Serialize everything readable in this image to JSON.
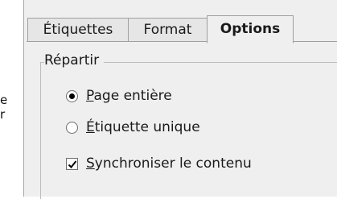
{
  "edge_text": [
    "e",
    "r"
  ],
  "tabs": [
    {
      "label": "Étiquettes"
    },
    {
      "label": "Format"
    },
    {
      "label": "Options",
      "active": true
    }
  ],
  "group": {
    "title": "Répartir",
    "radios": [
      {
        "label_underlined": "P",
        "label_rest": "age entière",
        "checked": true
      },
      {
        "label_underlined": "É",
        "label_rest": "tiquette unique",
        "checked": false
      }
    ],
    "checkbox": {
      "label_underlined": "S",
      "label_rest": "ynchroniser le contenu",
      "checked": true
    }
  }
}
